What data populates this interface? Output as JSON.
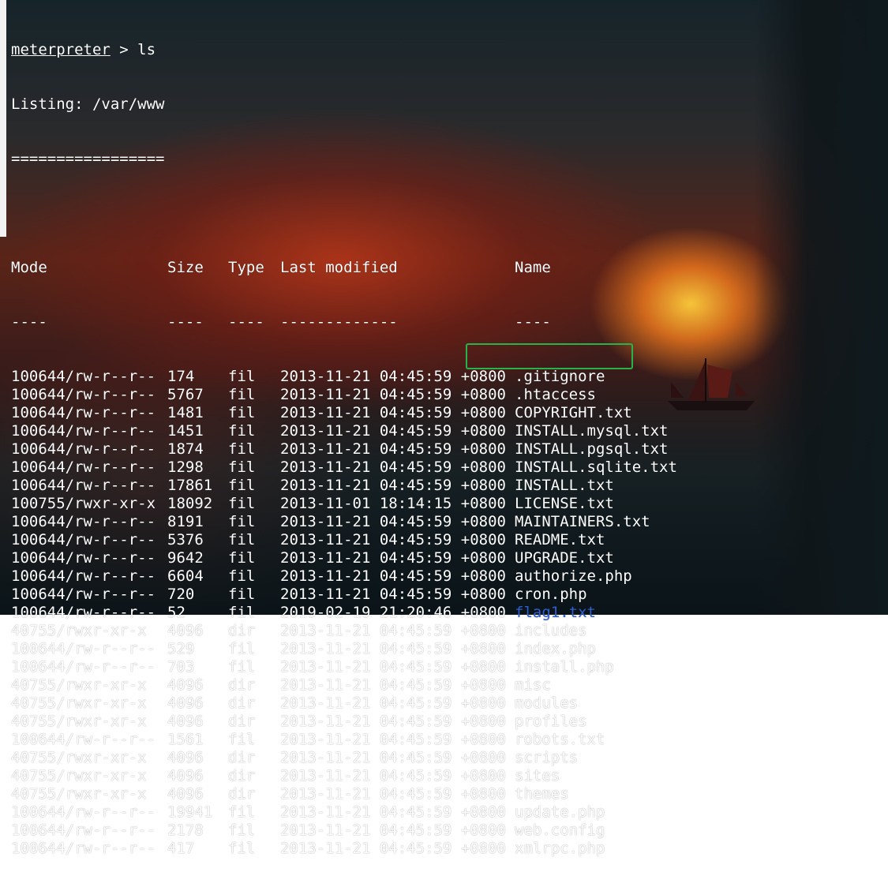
{
  "terminal": {
    "prompt": "meterpreter",
    "prompt_sep": " > ",
    "command": "ls",
    "listing_line": "Listing: /var/www",
    "separator": "=================",
    "headers": {
      "mode": "Mode",
      "size": "Size",
      "type": "Type",
      "modified": "Last modified",
      "name": "Name"
    },
    "header_underlines": {
      "mode": "----",
      "size": "----",
      "type": "----",
      "modified": "-------------",
      "name": "----"
    },
    "rows": [
      {
        "mode": "100644/rw-r--r--",
        "size": "174",
        "type": "fil",
        "modified": "2013-11-21 04:45:59 +0800",
        "name": ".gitignore"
      },
      {
        "mode": "100644/rw-r--r--",
        "size": "5767",
        "type": "fil",
        "modified": "2013-11-21 04:45:59 +0800",
        "name": ".htaccess"
      },
      {
        "mode": "100644/rw-r--r--",
        "size": "1481",
        "type": "fil",
        "modified": "2013-11-21 04:45:59 +0800",
        "name": "COPYRIGHT.txt"
      },
      {
        "mode": "100644/rw-r--r--",
        "size": "1451",
        "type": "fil",
        "modified": "2013-11-21 04:45:59 +0800",
        "name": "INSTALL.mysql.txt"
      },
      {
        "mode": "100644/rw-r--r--",
        "size": "1874",
        "type": "fil",
        "modified": "2013-11-21 04:45:59 +0800",
        "name": "INSTALL.pgsql.txt"
      },
      {
        "mode": "100644/rw-r--r--",
        "size": "1298",
        "type": "fil",
        "modified": "2013-11-21 04:45:59 +0800",
        "name": "INSTALL.sqlite.txt"
      },
      {
        "mode": "100644/rw-r--r--",
        "size": "17861",
        "type": "fil",
        "modified": "2013-11-21 04:45:59 +0800",
        "name": "INSTALL.txt"
      },
      {
        "mode": "100755/rwxr-xr-x",
        "size": "18092",
        "type": "fil",
        "modified": "2013-11-01 18:14:15 +0800",
        "name": "LICENSE.txt"
      },
      {
        "mode": "100644/rw-r--r--",
        "size": "8191",
        "type": "fil",
        "modified": "2013-11-21 04:45:59 +0800",
        "name": "MAINTAINERS.txt"
      },
      {
        "mode": "100644/rw-r--r--",
        "size": "5376",
        "type": "fil",
        "modified": "2013-11-21 04:45:59 +0800",
        "name": "README.txt"
      },
      {
        "mode": "100644/rw-r--r--",
        "size": "9642",
        "type": "fil",
        "modified": "2013-11-21 04:45:59 +0800",
        "name": "UPGRADE.txt"
      },
      {
        "mode": "100644/rw-r--r--",
        "size": "6604",
        "type": "fil",
        "modified": "2013-11-21 04:45:59 +0800",
        "name": "authorize.php"
      },
      {
        "mode": "100644/rw-r--r--",
        "size": "720",
        "type": "fil",
        "modified": "2013-11-21 04:45:59 +0800",
        "name": "cron.php"
      },
      {
        "mode": "100644/rw-r--r--",
        "size": "52",
        "type": "fil",
        "modified": "2019-02-19 21:20:46 +0800",
        "name": "flag1.txt"
      },
      {
        "mode": "40755/rwxr-xr-x",
        "size": "4096",
        "type": "dir",
        "modified": "2013-11-21 04:45:59 +0800",
        "name": "includes"
      },
      {
        "mode": "100644/rw-r--r--",
        "size": "529",
        "type": "fil",
        "modified": "2013-11-21 04:45:59 +0800",
        "name": "index.php"
      },
      {
        "mode": "100644/rw-r--r--",
        "size": "703",
        "type": "fil",
        "modified": "2013-11-21 04:45:59 +0800",
        "name": "install.php"
      },
      {
        "mode": "40755/rwxr-xr-x",
        "size": "4096",
        "type": "dir",
        "modified": "2013-11-21 04:45:59 +0800",
        "name": "misc"
      },
      {
        "mode": "40755/rwxr-xr-x",
        "size": "4096",
        "type": "dir",
        "modified": "2013-11-21 04:45:59 +0800",
        "name": "modules"
      },
      {
        "mode": "40755/rwxr-xr-x",
        "size": "4096",
        "type": "dir",
        "modified": "2013-11-21 04:45:59 +0800",
        "name": "profiles"
      },
      {
        "mode": "100644/rw-r--r--",
        "size": "1561",
        "type": "fil",
        "modified": "2013-11-21 04:45:59 +0800",
        "name": "robots.txt"
      },
      {
        "mode": "40755/rwxr-xr-x",
        "size": "4096",
        "type": "dir",
        "modified": "2013-11-21 04:45:59 +0800",
        "name": "scripts"
      },
      {
        "mode": "40755/rwxr-xr-x",
        "size": "4096",
        "type": "dir",
        "modified": "2013-11-21 04:45:59 +0800",
        "name": "sites"
      },
      {
        "mode": "40755/rwxr-xr-x",
        "size": "4096",
        "type": "dir",
        "modified": "2013-11-21 04:45:59 +0800",
        "name": "themes"
      },
      {
        "mode": "100644/rw-r--r--",
        "size": "19941",
        "type": "fil",
        "modified": "2013-11-21 04:45:59 +0800",
        "name": "update.php"
      },
      {
        "mode": "100644/rw-r--r--",
        "size": "2178",
        "type": "fil",
        "modified": "2013-11-21 04:45:59 +0800",
        "name": "web.config"
      },
      {
        "mode": "100644/rw-r--r--",
        "size": "417",
        "type": "fil",
        "modified": "2013-11-21 04:45:59 +0800",
        "name": "xmlrpc.php"
      }
    ]
  },
  "colors": {
    "text": "#ffffff",
    "highlighted_file": "#2f5fd0",
    "highlight_box": "#29b24a"
  }
}
